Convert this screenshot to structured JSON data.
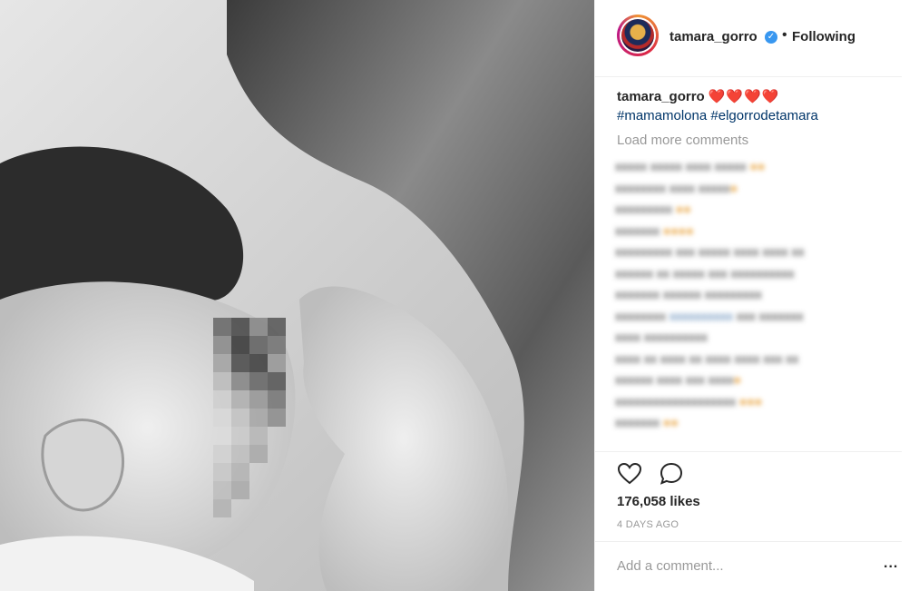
{
  "post": {
    "username": "tamara_gorro",
    "separator": "•",
    "follow_status": "Following",
    "verified_icon": "verified-badge-icon",
    "caption": {
      "username": "tamara_gorro",
      "hearts": "❤️❤️❤️❤️",
      "hashtags": "#mamamolona #elgorrodetamara"
    },
    "load_more_label": "Load more comments",
    "comments_blurred": true,
    "likes": "176,058 likes",
    "time_ago": "4 DAYS AGO",
    "add_comment_placeholder": "Add a comment...",
    "more_options_label": "..."
  },
  "icons": {
    "like": "heart-icon",
    "comment": "comment-bubble-icon",
    "options": "more-options-icon"
  },
  "colors": {
    "link": "#003569",
    "muted": "#999999",
    "verified": "#3897f0",
    "text": "#262626"
  }
}
